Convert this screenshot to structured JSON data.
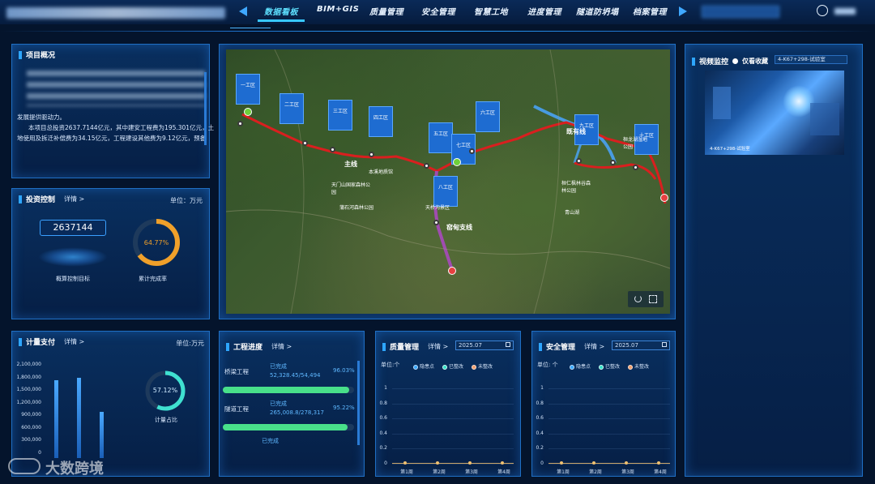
{
  "header": {
    "nav": [
      {
        "label": "数据看板",
        "active": true
      },
      {
        "label": "BIM+GIS",
        "active": false
      },
      {
        "label": "质量管理",
        "active": false
      },
      {
        "label": "安全管理",
        "active": false
      },
      {
        "label": "智慧工地",
        "active": false
      },
      {
        "label": "进度管理",
        "active": false
      },
      {
        "label": "隧道防坍塌",
        "active": false
      },
      {
        "label": "档案管理",
        "active": false
      }
    ]
  },
  "overview": {
    "title": "项目概况",
    "text_visible_1": "发展提供驱动力。",
    "text_visible_2": "本项目总投资2637.7144亿元，其中建安工程费为195.301亿元，土",
    "text_visible_3": "地使用及拆迁补偿费为34.15亿元，工程建设其他费为9.12亿元，预备"
  },
  "investment": {
    "title": "投资控制",
    "detail": "详情 >",
    "unit": "单位：万元",
    "value": "2637144",
    "value_label": "概算控制目标",
    "ring_percent": "64.77%",
    "ring_fraction": 0.6477,
    "ring_label": "累计完成率"
  },
  "payment": {
    "title": "计量支付",
    "detail": "详情 >",
    "unit": "单位:万元",
    "ring_percent": "57.12%",
    "ring_fraction": 0.5712,
    "ring_label": "计量占比",
    "yticks": [
      "2,100,000",
      "1,800,000",
      "1,500,000",
      "1,200,000",
      "900,000",
      "600,000",
      "300,000",
      "0"
    ]
  },
  "progress": {
    "title": "工程进度",
    "detail": "详情 >",
    "items": [
      {
        "name": "桥梁工程",
        "status": "已完成",
        "amount": "52,328.45/54,494",
        "percent": "96.03%",
        "fraction": 0.9603
      },
      {
        "name": "隧道工程",
        "status": "已完成",
        "amount": "265,008.8/278,317",
        "percent": "95.22%",
        "fraction": 0.9522
      },
      {
        "name": "",
        "status": "已完成",
        "amount": "",
        "percent": "",
        "fraction": 0
      }
    ]
  },
  "quality": {
    "title": "质量管理",
    "detail": "详情 >",
    "date": "2025.07",
    "unit": "单位:个",
    "legend": [
      "隐患点",
      "已整改",
      "未整改"
    ],
    "yticks": [
      "1",
      "0.8",
      "0.6",
      "0.4",
      "0.2",
      "0"
    ],
    "weeks": [
      "第1周",
      "第2周",
      "第3周",
      "第4周"
    ]
  },
  "safety": {
    "title": "安全管理",
    "detail": "详情 >",
    "date": "2025.07",
    "unit": "单位: 个",
    "legend": [
      "隐患点",
      "已整改",
      "未整改"
    ],
    "yticks": [
      "1",
      "0.8",
      "0.6",
      "0.4",
      "0.2",
      "0"
    ],
    "weeks": [
      "第1周",
      "第2周",
      "第3周",
      "第4周"
    ]
  },
  "video": {
    "title": "视频监控",
    "favorite": "仅看收藏",
    "camera": "4-K67+298-试验室",
    "overlay": "4-K67+298-试验室"
  },
  "map": {
    "labels": [
      "一工区",
      "二工区",
      "三工区",
      "四工区",
      "五工区",
      "六工区",
      "七工区",
      "八工区",
      "九工区",
      "十工区"
    ],
    "main_line": "主线",
    "branch_line": "窑甸支线",
    "existing_line": "既有线",
    "pois": [
      "本溪地质馆",
      "天门山国家森林公园",
      "蒲石河森林公园",
      "天桥沟景区",
      "桓仁枫林谷森林公园",
      "青山湖",
      "桓龙湖湿地公园"
    ]
  },
  "watermark": "大数跨境"
}
